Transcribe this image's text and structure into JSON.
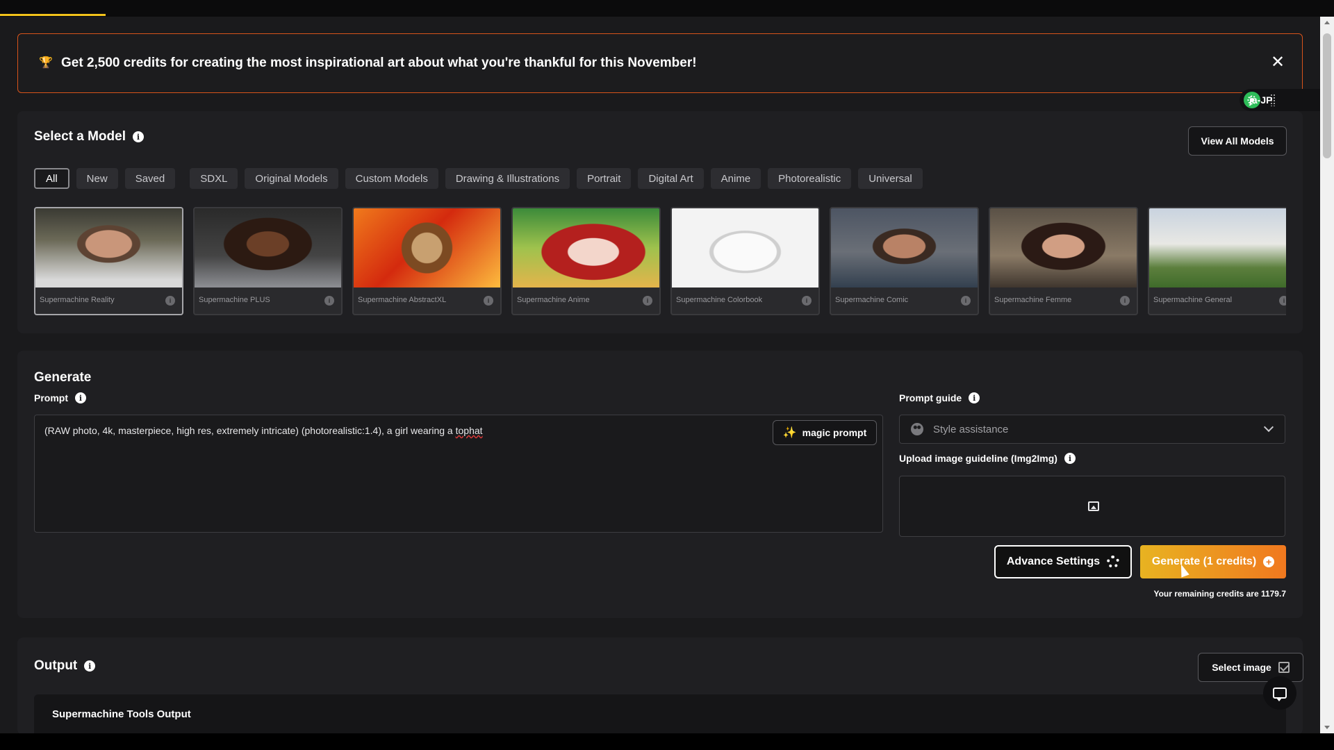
{
  "banner": {
    "icon": "trophy-icon",
    "text": "Get 2,500 credits for creating the most inspirational art about what you're thankful for this November!",
    "accent": "#d8541a"
  },
  "language": {
    "label": "ja-JP"
  },
  "models": {
    "title": "Select a Model",
    "view_all": "View All Models",
    "chips": [
      "All",
      "New",
      "Saved",
      "SDXL",
      "Original Models",
      "Custom Models",
      "Drawing & Illustrations",
      "Portrait",
      "Digital Art",
      "Anime",
      "Photorealistic",
      "Universal"
    ],
    "active_chip": "All",
    "cards": [
      {
        "name": "Supermachine Reality"
      },
      {
        "name": "Supermachine PLUS"
      },
      {
        "name": "Supermachine AbstractXL"
      },
      {
        "name": "Supermachine Anime"
      },
      {
        "name": "Supermachine Colorbook"
      },
      {
        "name": "Supermachine Comic"
      },
      {
        "name": "Supermachine Femme"
      },
      {
        "name": "Supermachine General"
      }
    ]
  },
  "generate": {
    "title": "Generate",
    "prompt_label": "Prompt",
    "prompt_text_main": "(RAW photo, 4k, masterpiece, high res, extremely intricate) (photorealistic:1.4), a girl wearing a ",
    "prompt_text_last": "tophat",
    "magic_prompt": "magic prompt",
    "prompt_guide_label": "Prompt guide",
    "style_placeholder": "Style assistance",
    "upload_label": "Upload image guideline (Img2Img)",
    "advance_settings": "Advance Settings",
    "generate_button": "Generate (1 credits)",
    "credits_text": "Your remaining credits are 1179.7",
    "accent_start": "#e8b321",
    "accent_end": "#f0781f"
  },
  "output": {
    "title": "Output",
    "select_image": "Select image",
    "tools_output": "Supermachine Tools Output"
  }
}
